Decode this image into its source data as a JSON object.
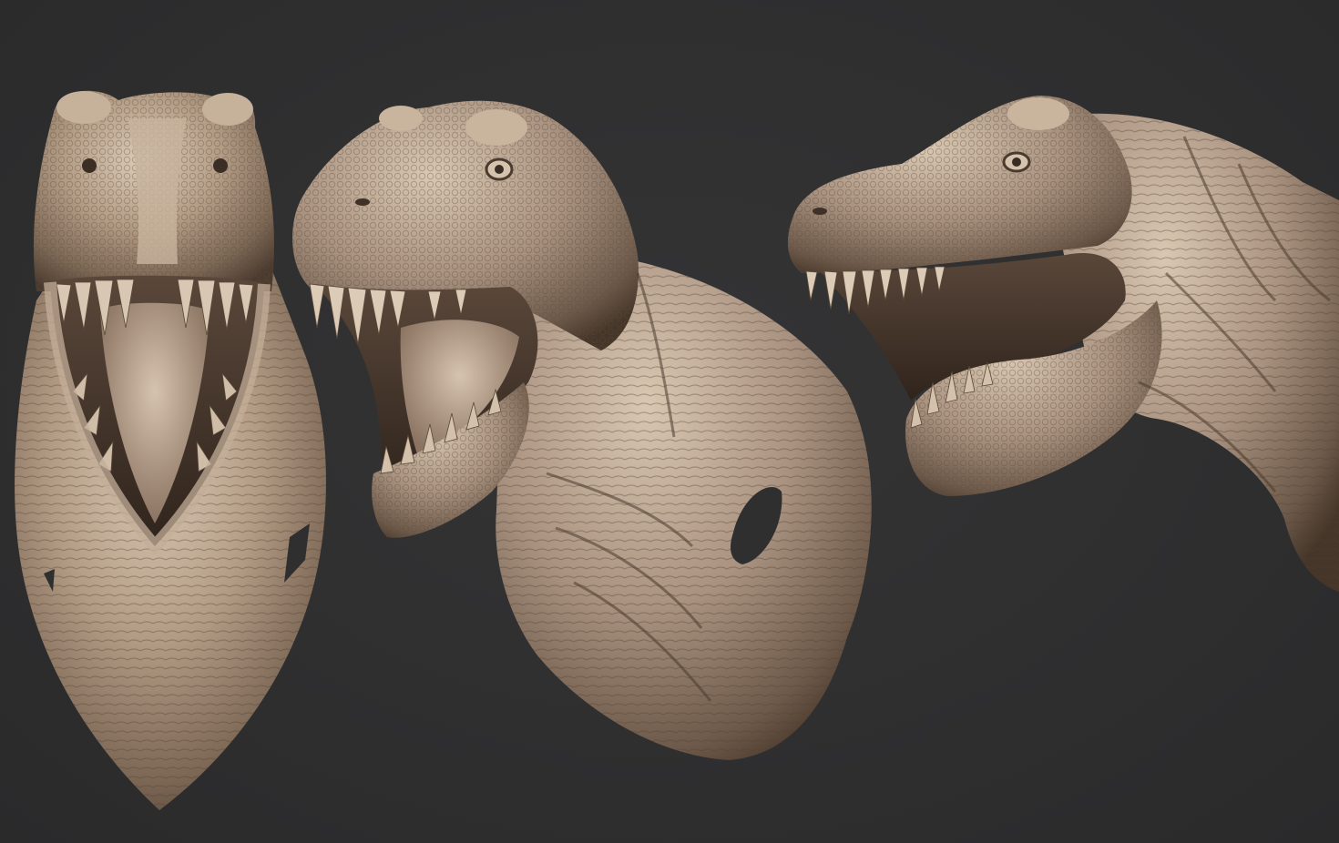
{
  "scene": {
    "background_color": "#2f2f30",
    "sculpt_color": "#b5a08a",
    "shadow_color": "#4a3b2e",
    "highlight_color": "#e2d3c0",
    "views": [
      {
        "name": "front-view"
      },
      {
        "name": "three-quarter-view"
      },
      {
        "name": "side-view"
      }
    ]
  }
}
